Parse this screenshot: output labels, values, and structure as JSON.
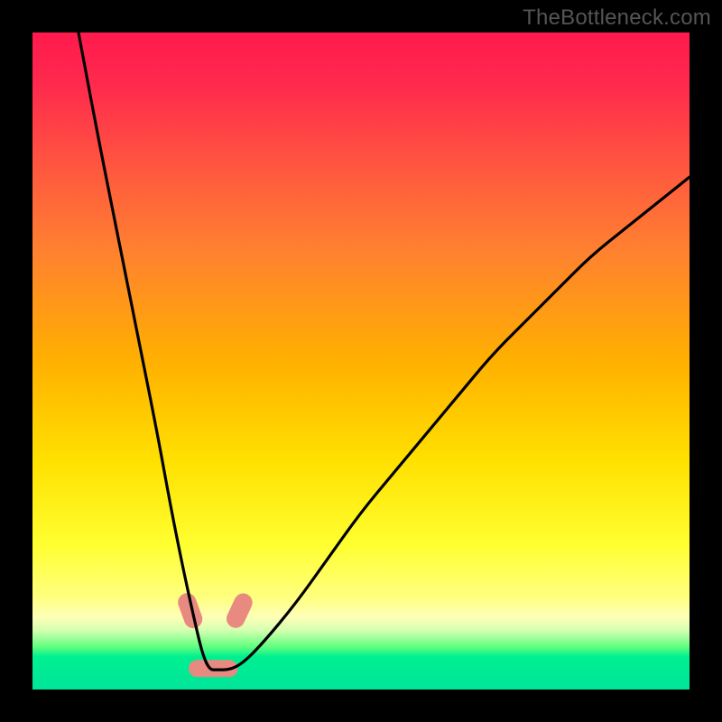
{
  "watermark": "TheBottleneck.com",
  "chart_data": {
    "type": "line",
    "title": "",
    "xlabel": "",
    "ylabel": "",
    "xlim": [
      0,
      100
    ],
    "ylim": [
      0,
      100
    ],
    "grid": false,
    "legend": false,
    "background_gradient": {
      "direction": "vertical",
      "stops": [
        {
          "pos": 0.0,
          "color": "#ff1a4d"
        },
        {
          "pos": 0.08,
          "color": "#ff2a4d"
        },
        {
          "pos": 0.2,
          "color": "#ff5540"
        },
        {
          "pos": 0.33,
          "color": "#ff8030"
        },
        {
          "pos": 0.5,
          "color": "#ffb000"
        },
        {
          "pos": 0.65,
          "color": "#ffe000"
        },
        {
          "pos": 0.78,
          "color": "#ffff30"
        },
        {
          "pos": 0.86,
          "color": "#ffff80"
        },
        {
          "pos": 0.89,
          "color": "#feffb8"
        },
        {
          "pos": 0.91,
          "color": "#d4ffb0"
        },
        {
          "pos": 0.935,
          "color": "#60ff80"
        },
        {
          "pos": 0.95,
          "color": "#00f090"
        },
        {
          "pos": 1.0,
          "color": "#00e49a"
        }
      ]
    },
    "series": [
      {
        "name": "bottleneck-curve",
        "color": "#000000",
        "x": [
          7,
          10,
          13,
          16,
          19,
          21,
          23,
          25,
          26,
          27,
          28,
          30,
          32,
          35,
          40,
          45,
          50,
          55,
          60,
          65,
          70,
          75,
          80,
          85,
          90,
          95,
          100
        ],
        "y": [
          100,
          84,
          69,
          54,
          39,
          28,
          18,
          9,
          5,
          3,
          3,
          3,
          4,
          7,
          13,
          20,
          27,
          33,
          39,
          45,
          51,
          56,
          61,
          66,
          70,
          74,
          78
        ]
      }
    ],
    "markers": [
      {
        "name": "valley-left-marker",
        "x": 24.0,
        "y": 12.0,
        "color": "#e88a80",
        "w": 2.8,
        "h": 5.5,
        "rot": -20
      },
      {
        "name": "valley-right-marker",
        "x": 31.5,
        "y": 12.0,
        "color": "#e88a80",
        "w": 2.8,
        "h": 5.5,
        "rot": 25
      },
      {
        "name": "valley-floor-marker",
        "x": 27.5,
        "y": 3.2,
        "color": "#e88a80",
        "w": 7.5,
        "h": 2.6,
        "rot": 0
      }
    ]
  }
}
